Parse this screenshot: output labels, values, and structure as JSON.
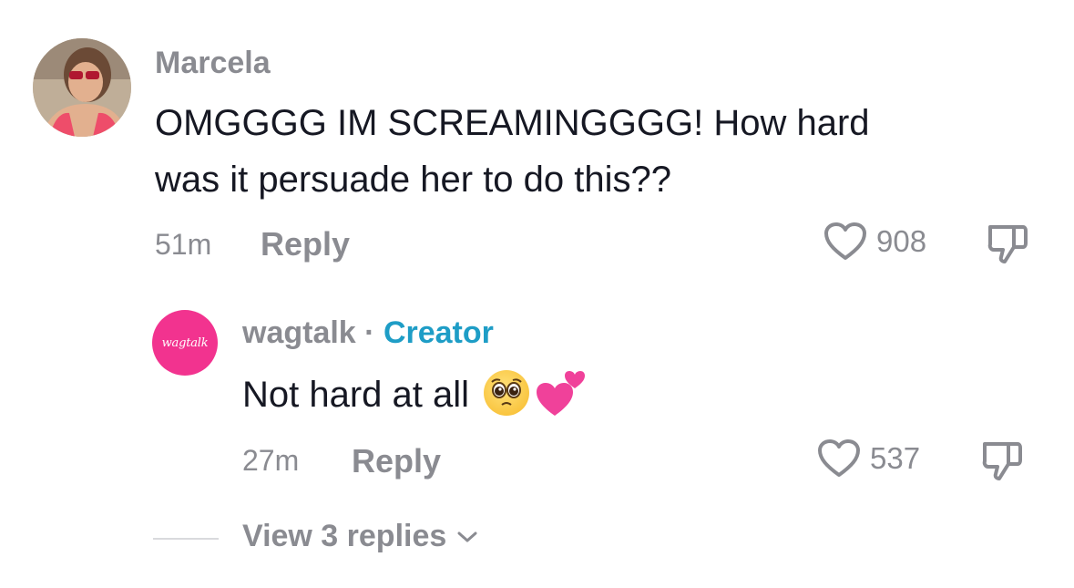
{
  "comments": [
    {
      "username": "Marcela",
      "text_line1": "OMGGGG IM SCREAMINGGGG! How hard",
      "text_line2": "was it persuade her to do this??",
      "time": "51m",
      "reply_label": "Reply",
      "likes": "908",
      "like_icon": "heart-outline-icon",
      "dislike_icon": "thumbs-down-icon"
    },
    {
      "username": "wagtalk",
      "separator": "·",
      "badge": "Creator",
      "avatar_text": "wagtalk",
      "text": "Not hard at all",
      "emojis": [
        "pleading-face-emoji",
        "two-hearts-emoji"
      ],
      "time": "27m",
      "reply_label": "Reply",
      "likes": "537",
      "like_icon": "heart-outline-icon",
      "dislike_icon": "thumbs-down-icon"
    }
  ],
  "view_replies": {
    "label": "View 3 replies",
    "icon": "chevron-down-icon"
  },
  "colors": {
    "text": "#161823",
    "muted": "#8a8b91",
    "creator": "#1e9dc6",
    "brand": "#f2338f"
  }
}
